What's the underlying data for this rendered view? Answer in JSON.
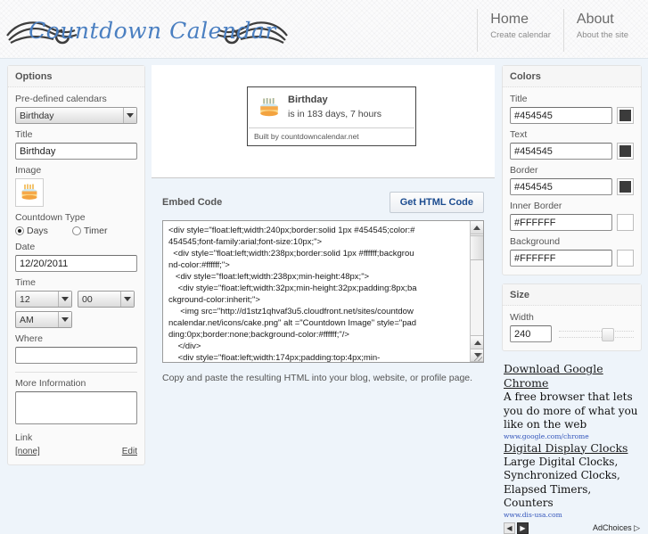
{
  "site": {
    "logo_text": "Countdown Calendar"
  },
  "nav": [
    {
      "title": "Home",
      "sub": "Create calendar"
    },
    {
      "title": "About",
      "sub": "About the site"
    }
  ],
  "options": {
    "panel_title": "Options",
    "predefined_label": "Pre-defined calendars",
    "predefined_value": "Birthday",
    "predefined_options": [
      "Birthday"
    ],
    "title_label": "Title",
    "title_value": "Birthday",
    "image_label": "Image",
    "image_icon": "birthday-cake-icon",
    "countdown_type_label": "Countdown Type",
    "type_days_label": "Days",
    "type_timer_label": "Timer",
    "type_selected": "Days",
    "date_label": "Date",
    "date_value": "12/20/2011",
    "time_label": "Time",
    "hour_value": "12",
    "minute_value": "00",
    "meridiem_value": "AM",
    "where_label": "Where",
    "where_value": "",
    "more_info_label": "More Information",
    "more_info_value": "",
    "link_label": "Link",
    "link_value": "[none]",
    "link_edit": "Edit"
  },
  "preview": {
    "title": "Birthday",
    "subtitle": "is in 183 days, 7 hours",
    "footer": "Built by countdowncalendar.net",
    "icon": "birthday-cake-icon"
  },
  "embed": {
    "label": "Embed Code",
    "button": "Get HTML Code",
    "code": "<div style=\"float:left;width:240px;border:solid 1px #454545;color:#454545;font-family:arial;font-size:10px;\">\n  <div style=\"float:left;width:238px;border:solid 1px #ffffff;background-color:#ffffff;\">\n   <div style=\"float:left;width:238px;min-height:48px;\">\n    <div style=\"float:left;width:32px;min-height:32px;padding:8px;background-color:inherit;\">\n     <img src=\"http://d1stz1qhvaf3u5.cloudfront.net/sites/countdowncalendar.net/icons/cake.png\" alt =\"Countdown Image\" style=\"padding:0px;border:none;background-color:#ffffff;\"/>\n    </div>\n    <div style=\"float:left;width:174px;padding:top:4px;min-",
    "note": "Copy and paste the resulting HTML into your blog, website, or profile page."
  },
  "colors": {
    "panel_title": "Colors",
    "fields": [
      {
        "label": "Title",
        "value": "#454545",
        "swatch": "#3b3b3b"
      },
      {
        "label": "Text",
        "value": "#454545",
        "swatch": "#3b3b3b"
      },
      {
        "label": "Border",
        "value": "#454545",
        "swatch": "#3b3b3b"
      },
      {
        "label": "Inner Border",
        "value": "#FFFFFF",
        "swatch": "#ffffff"
      },
      {
        "label": "Background",
        "value": "#FFFFFF",
        "swatch": "#ffffff"
      }
    ]
  },
  "size": {
    "panel_title": "Size",
    "width_label": "Width",
    "width_value": "240"
  },
  "ads": [
    {
      "title": "Download Google Chrome",
      "body": "A free browser that lets you do more of what you like on the web",
      "url": "www.google.com/chrome"
    },
    {
      "title": "Digital Display Clocks",
      "body": "Large Digital Clocks, Synchronized Clocks, Elapsed Timers, Counters",
      "url": "www.dis-usa.com"
    }
  ],
  "ad_footer": {
    "prev": "◀",
    "next": "▶",
    "label": "AdChoices ▷"
  }
}
